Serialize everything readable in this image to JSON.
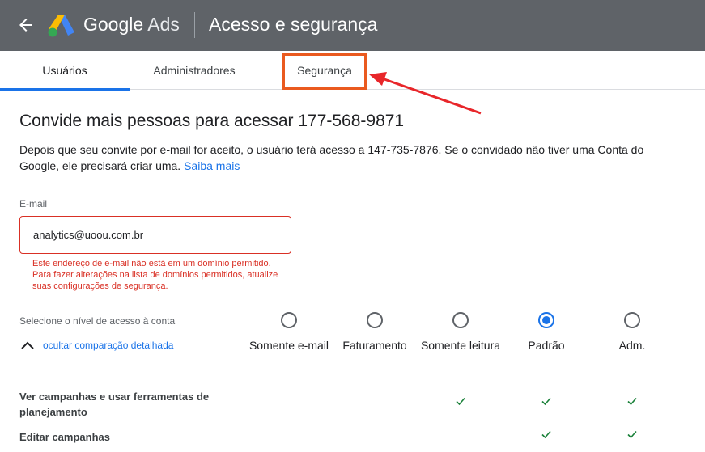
{
  "header": {
    "brand_primary": "Google",
    "brand_secondary": "Ads",
    "page_title": "Acesso e segurança",
    "back_icon": "arrow-left-icon",
    "colors": {
      "bar": "#5f6368"
    }
  },
  "tabs": [
    {
      "label": "Usuários",
      "active": true
    },
    {
      "label": "Administradores",
      "active": false
    },
    {
      "label": "Segurança",
      "active": false,
      "highlighted": true
    }
  ],
  "annotation": {
    "highlight_color": "#ea5a1f",
    "arrow_color": "#e8262a"
  },
  "invite": {
    "title": "Convide mais pessoas para acessar 177-568-9871",
    "description": "Depois que seu convite por e-mail for aceito, o usuário terá acesso a 147-735-7876. Se o convidado não tiver uma Conta do Google, ele precisará criar uma.",
    "learn_more": "Saiba mais",
    "email_label": "E-mail",
    "email_value": "analytics@uoou.com.br",
    "email_error": "Este endereço de e-mail não está em um domínio permitido. Para fazer alterações na lista de domínios permitidos, atualize suas configurações de segurança."
  },
  "access": {
    "label": "Selecione o nível de acesso à conta",
    "toggle_label": "ocultar comparação detalhada",
    "levels": [
      {
        "label": "Somente e-mail",
        "selected": false
      },
      {
        "label": "Faturamento",
        "selected": false
      },
      {
        "label": "Somente leitura",
        "selected": false
      },
      {
        "label": "Padrão",
        "selected": true
      },
      {
        "label": "Adm.",
        "selected": false
      }
    ],
    "permissions": [
      {
        "label": "Ver campanhas e usar ferramentas de planejamento",
        "allowed": [
          false,
          false,
          true,
          true,
          true
        ]
      },
      {
        "label": "Editar campanhas",
        "allowed": [
          false,
          false,
          false,
          true,
          true
        ]
      }
    ]
  },
  "colors": {
    "accent": "#1a73e8",
    "error": "#d93025",
    "check": "#188038"
  }
}
